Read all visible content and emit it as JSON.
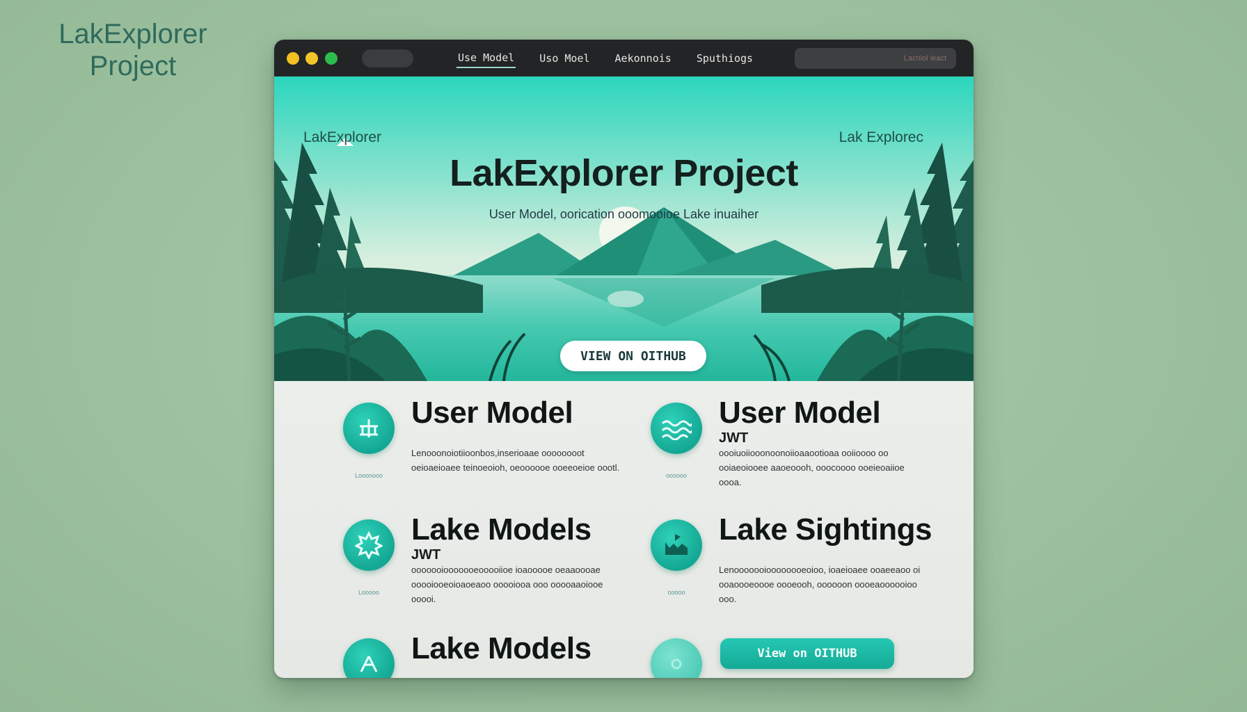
{
  "corner_logo": {
    "line1": "LakExplorer",
    "line2": "Project"
  },
  "titlebar": {
    "nav": [
      {
        "label": "Use Model"
      },
      {
        "label": "Uso Moel"
      },
      {
        "label": "Aekonnois"
      },
      {
        "label": "Sputhiogs"
      }
    ],
    "url_text": "Lacniol ieact",
    "dot_colors": [
      "#f2bf24",
      "#f3c52a",
      "#2dbd4e"
    ]
  },
  "hero": {
    "brand_left": "LakExplorer",
    "brand_right": "Lak Explorec",
    "title": "LakExplorer Project",
    "subtitle": "User Model, oorication ooomooioe Lake inuaiher",
    "cta_label": "VIEW ON OITHUB"
  },
  "features": {
    "cards": [
      {
        "title": "User Model",
        "badge": "",
        "icon": "building-icon",
        "icon_caption": "Looonooo",
        "desc": "Lenooonoiotiioonbos,inserioaae oooooooot oeioaeioaee teinoeoioh, oeoooooe ooeeoeioe oootl."
      },
      {
        "title": "User Model",
        "badge": "JWT",
        "icon": "waves-icon",
        "icon_caption": "oooooo",
        "desc": "oooiuoiiooonoonoiioaaootioaa ooiioooo oo ooiaeoiooee aaoeoooh, ooocoooo ooeieoaiioe oooa."
      },
      {
        "title": "Lake Models",
        "badge": "JWT",
        "icon": "gear-icon",
        "icon_caption": "Looooo",
        "desc": "ooooooiooooooeooooiioe ioaooooe oeaaoooae ooooiooeoioaoeaoo ooooiooa ooo ooooaaoiooe ooooi."
      },
      {
        "title": "Lake Sightings",
        "badge": "",
        "icon": "boat-icon",
        "icon_caption": "ooooo",
        "desc": "Lenooooooioooooooeoioo, ioaeioaee ooaeeaoo oi ooaoooeoooe oooeooh, oooooon oooeaoooooioo ooo."
      },
      {
        "title": "Lake Models",
        "badge": "",
        "icon": "tent-icon",
        "icon_caption": "",
        "desc": ""
      },
      {
        "title": "",
        "badge": "",
        "icon": "leaf-icon",
        "icon_caption": "",
        "desc": ""
      }
    ],
    "cta_label": "View on OITHUB"
  },
  "colors": {
    "accent": "#1fbfa9",
    "hero_top": "#2ad8bd",
    "titlebar": "#232425",
    "background": "#9dc19f"
  }
}
